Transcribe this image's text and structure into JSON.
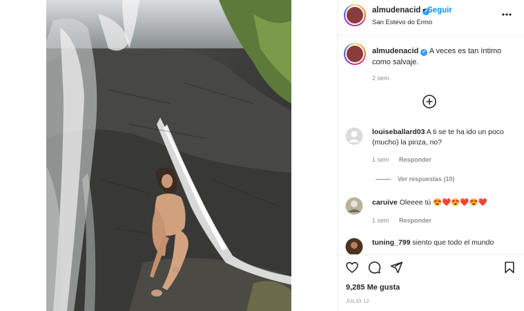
{
  "post": {
    "username": "almudenacid",
    "follow_label": "Seguir",
    "separator": "•",
    "location": "San Estevo do Ermo",
    "photo_alt": "waterfall-photo"
  },
  "caption": {
    "username": "almudenacid",
    "text": "A veces es tan íntimo como salvaje.",
    "time": "2 sem"
  },
  "comments": [
    {
      "username": "louiseballard03",
      "text": "A ti se te ha ido un poco (mucho) la pinza, no?",
      "time": "1 sem",
      "reply_label": "Responder",
      "view_replies": "Ver respuestas (10)"
    },
    {
      "username": "caruive",
      "text": "Oleeee tú 😍❤️😍❤️😍❤️",
      "time": "1 sem",
      "reply_label": "Responder"
    },
    {
      "username": "tuning_799",
      "text": "siento que todo el mundo"
    }
  ],
  "footer": {
    "likes": "9,285 Me gusta",
    "date": "JULIO 12"
  },
  "colors": {
    "accent": "#0095f6",
    "verified": "#3897f0",
    "muted": "#8e8e8e",
    "heart": "#ed4956"
  },
  "icons": [
    "verified-icon",
    "more-options-icon",
    "add-comment-icon",
    "like-icon",
    "comment-icon",
    "share-icon",
    "save-icon"
  ]
}
